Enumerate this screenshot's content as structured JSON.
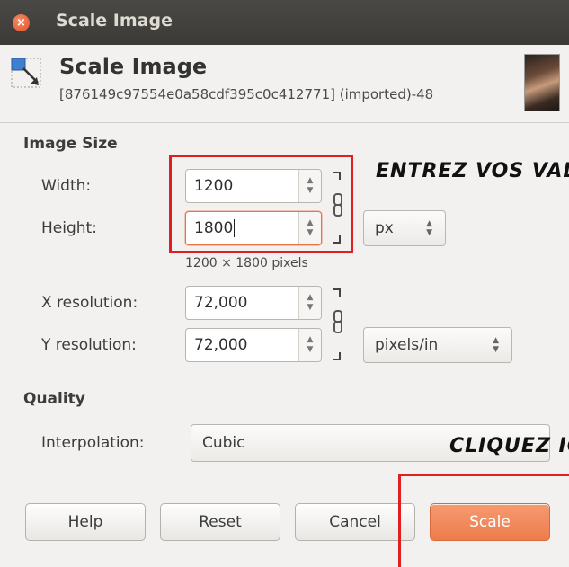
{
  "window": {
    "title": "Scale Image",
    "close_glyph": "×"
  },
  "header": {
    "title": "Scale Image",
    "subtitle": "[876149c97554e0a58cdf395c0c412771] (imported)-48",
    "icon": "scale-image-icon"
  },
  "image_size": {
    "section_label": "Image Size",
    "width_label": "Width:",
    "width_value": "1200",
    "height_label": "Height:",
    "height_value": "1800",
    "unit": "px",
    "pixel_info": "1200 × 1800 pixels",
    "x_res_label": "X resolution:",
    "x_res_value": "72,000",
    "y_res_label": "Y resolution:",
    "y_res_value": "72,000",
    "res_unit": "pixels/in"
  },
  "quality": {
    "section_label": "Quality",
    "interp_label": "Interpolation:",
    "interp_value": "Cubic"
  },
  "buttons": {
    "help": "Help",
    "reset": "Reset",
    "cancel": "Cancel",
    "scale": "Scale"
  },
  "annotations": {
    "enter_values": "ENTREZ VOS VAL",
    "click_here": "CLIQUEZ IC"
  },
  "colors": {
    "accent": "#ee7c4c",
    "annotation_red": "#e02020",
    "titlebar": "#3b3a36"
  }
}
